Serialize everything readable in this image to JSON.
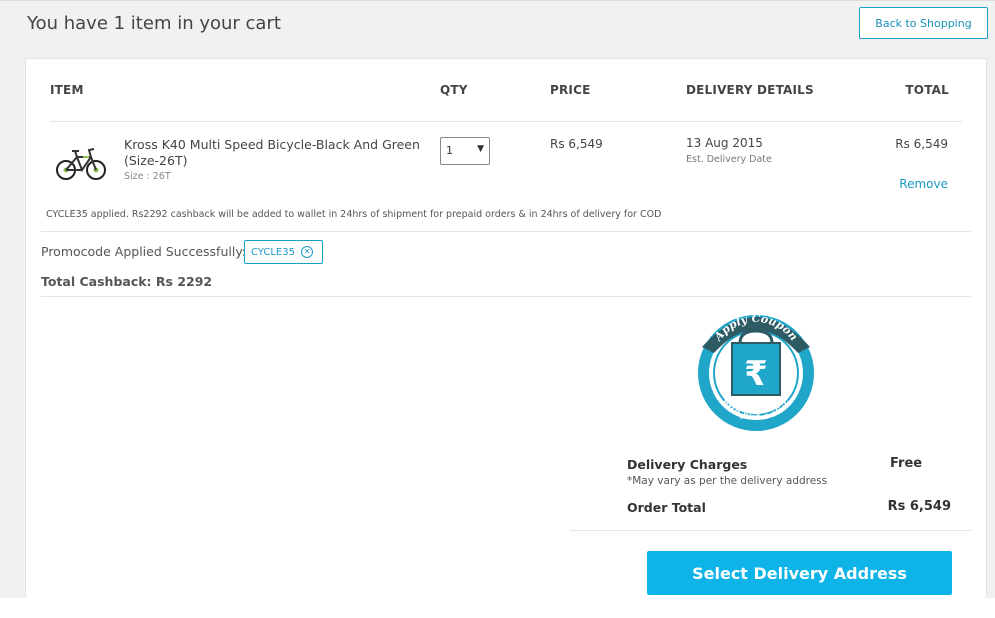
{
  "header": {
    "title": "You have 1 item in your cart",
    "back_label": "Back to Shopping"
  },
  "table": {
    "columns": [
      "ITEM",
      "QTY",
      "PRICE",
      "DELIVERY DETAILS",
      "TOTAL"
    ]
  },
  "item": {
    "name": "Kross K40 Multi Speed Bicycle-Black And Green (Size-26T)",
    "size": "Size : 26T",
    "qty": "1",
    "price": "Rs 6,549",
    "delivery_date": "13 Aug 2015",
    "delivery_label": "Est. Delivery Date",
    "total": "Rs 6,549",
    "remove_label": "Remove",
    "cashback_note": "CYCLE35 applied. Rs2292 cashback will be added to wallet in 24hrs of shipment for prepaid orders & in 24hrs of delivery for COD"
  },
  "promo": {
    "label": "Promocode Applied Successfully:",
    "code": "CYCLE35",
    "cashback": "Total Cashback: Rs 2292"
  },
  "coupon_badge": {
    "top_text": "Apply Coupon",
    "bottom_text": "with just a click",
    "symbol": "₹"
  },
  "summary": {
    "delivery_label": "Delivery Charges",
    "delivery_value": "Free",
    "delivery_note": "*May vary as per the delivery address",
    "order_total_label": "Order Total",
    "order_total_value": "Rs 6,549"
  },
  "cta_label": "Select Delivery Address",
  "colors": {
    "accent": "#0eb4e8",
    "link": "#1a9ac4",
    "coupon_ring": "#1fa6c9",
    "coupon_dark": "#2e5a63"
  }
}
